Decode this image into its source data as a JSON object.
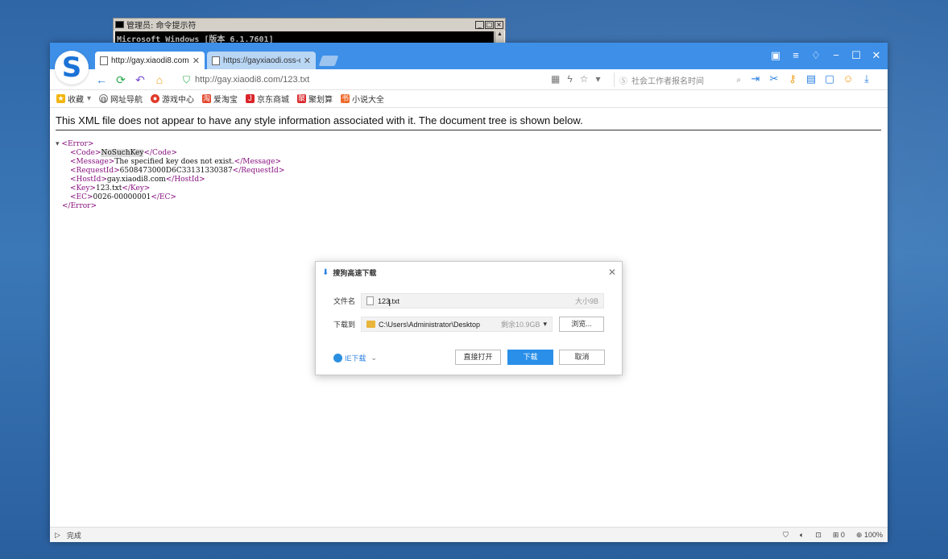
{
  "cmd": {
    "title": "管理员: 命令提示符",
    "line": "Microsoft Windows [版本 6.1.7601]"
  },
  "browser": {
    "tabs": [
      {
        "label": "http://gay.xiaodi8.com",
        "active": true
      },
      {
        "label": "https://gayxiaodi.oss-c",
        "active": false
      }
    ],
    "address": "http://gay.xiaodi8.com/123.txt",
    "search_placeholder": "社会工作者报名时间",
    "bookmarks": [
      {
        "label": "收藏",
        "icon": "star-icon"
      },
      {
        "label": "网址导航",
        "icon": "globe-icon"
      },
      {
        "label": "游戏中心",
        "icon": "game-icon"
      },
      {
        "label": "爱淘宝",
        "icon": "taobao-icon"
      },
      {
        "label": "京东商城",
        "icon": "jd-icon"
      },
      {
        "label": "聚划算",
        "icon": "juhuasuan-icon"
      },
      {
        "label": "小说大全",
        "icon": "novel-icon"
      }
    ],
    "content": {
      "notice": "This XML file does not appear to have any style information associated with it. The document tree is shown below.",
      "xml": {
        "root_open": "<Error>",
        "root_close": "</Error>",
        "code": "NoSuchKey",
        "message": "The specified key does not exist.",
        "request_id": "6508473000D6C33131330387",
        "host_id": "gay.xiaodi8.com",
        "key": "123.txt",
        "ec": "0026-00000001"
      }
    },
    "status": {
      "left_text": "完成",
      "zoom": "100%",
      "download_count": "0"
    }
  },
  "dialog": {
    "title": "搜狗高速下载",
    "filename_label": "文件名",
    "filename": "123.txt",
    "size_label": "大小9B",
    "saveto_label": "下载到",
    "path": "C:\\Users\\Administrator\\Desktop",
    "remaining": "剩余10.9GB",
    "browse": "浏览...",
    "ie_download": "IE下载",
    "open_direct": "直接打开",
    "download": "下载",
    "cancel": "取消"
  },
  "colors": {
    "titlebar": "#3d8fe8",
    "accent": "#2a8fe8",
    "desktop": "#2f66a6"
  }
}
